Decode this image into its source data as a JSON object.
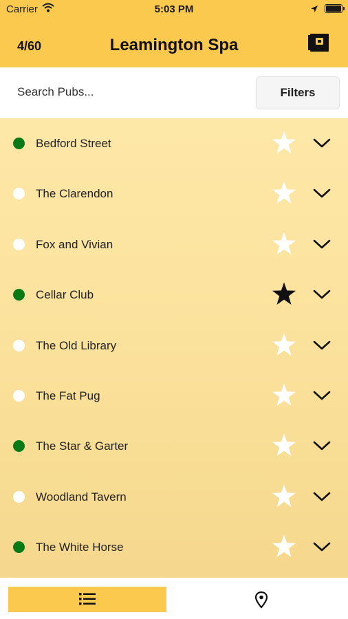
{
  "status_bar": {
    "carrier": "Carrier",
    "time": "5:03 PM"
  },
  "header": {
    "count": "4/60",
    "title": "Leamington Spa",
    "menu_icon": "book-menu-icon"
  },
  "search": {
    "placeholder": "Search Pubs...",
    "value": "",
    "filters_label": "Filters"
  },
  "colors": {
    "accent": "#fcc94f",
    "open_status": "#0a7a16",
    "closed_status": "#ffffff",
    "favorite_star": "#111111",
    "unfavorite_star": "#ffffff"
  },
  "pubs": [
    {
      "name": "Bedford Street",
      "status": "open",
      "favorite": false
    },
    {
      "name": "The Clarendon",
      "status": "closed",
      "favorite": false
    },
    {
      "name": "Fox and Vivian",
      "status": "closed",
      "favorite": false
    },
    {
      "name": "Cellar Club",
      "status": "open",
      "favorite": true
    },
    {
      "name": "The Old Library",
      "status": "closed",
      "favorite": false
    },
    {
      "name": "The Fat Pug",
      "status": "closed",
      "favorite": false
    },
    {
      "name": "The Star & Garter",
      "status": "open",
      "favorite": false
    },
    {
      "name": "Woodland Tavern",
      "status": "closed",
      "favorite": false
    },
    {
      "name": "The White Horse",
      "status": "open",
      "favorite": false
    }
  ],
  "tabs": [
    {
      "icon": "list-icon",
      "selected": true
    },
    {
      "icon": "map-pin-icon",
      "selected": false
    }
  ]
}
